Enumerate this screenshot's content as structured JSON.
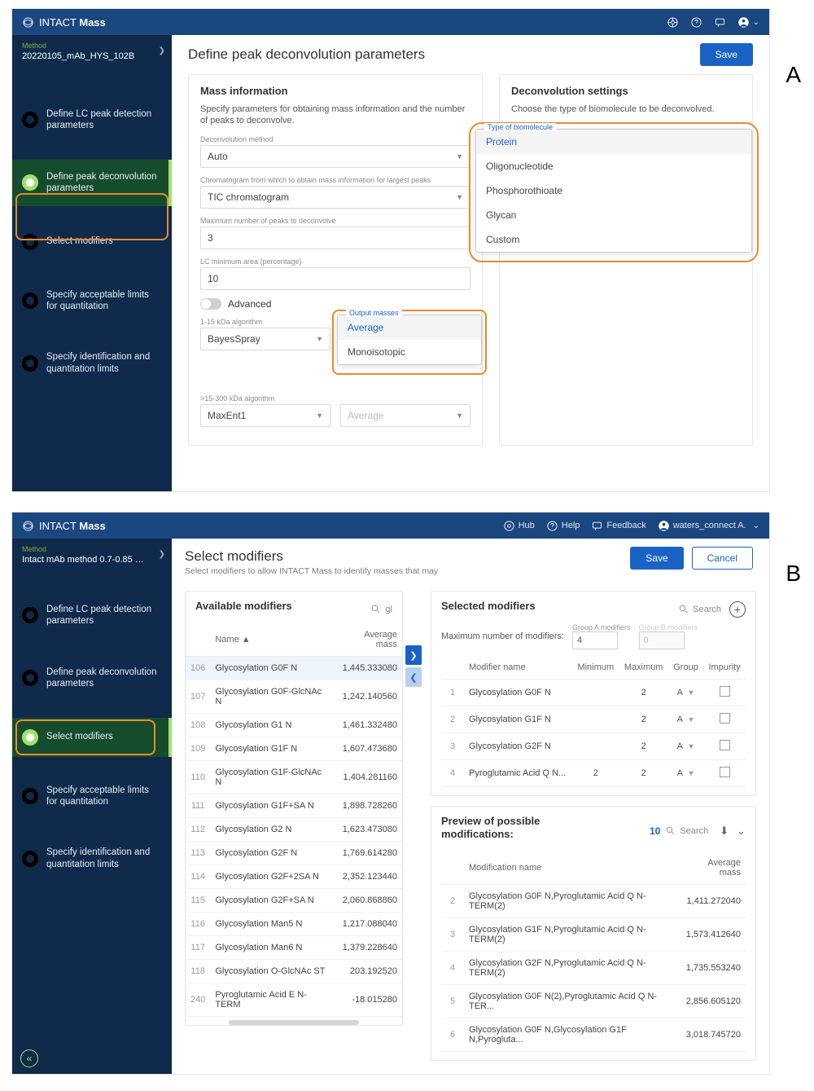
{
  "app_name_pre": "INTACT",
  "app_name_bold": "Mass",
  "hdr_icons": {
    "hub": "Hub",
    "help": "Help",
    "feedback": "Feedback",
    "user": "waters_connect A."
  },
  "panelA": {
    "label": "A",
    "method_label": "Method",
    "method_value": "20220105_mAb_HYS_102B",
    "steps": [
      "Define LC peak detection parameters",
      "Define peak deconvolution parameters",
      "Select modifiers",
      "Specify acceptable limits for quantitation",
      "Specify identification and quantitation limits"
    ],
    "title": "Define peak deconvolution parameters",
    "save": "Save",
    "mi": {
      "head": "Mass information",
      "note": "Specify parameters for obtaining mass information and the number of peaks to deconvolve.",
      "f1l": "Deconvolution method",
      "f1v": "Auto",
      "f2l": "Chromatogram from which to obtain mass information for largest peaks",
      "f2v": "TIC chromatogram",
      "f3l": "Maximum number of peaks to deconvolve",
      "f3v": "3",
      "f4l": "LC minimum area (percentage)",
      "f4v": "10",
      "adv": "Advanced",
      "f5l": "1-15 kDa algorithm",
      "f5v": "BayesSpray",
      "f6l": ">15-300 kDa algorithm",
      "f6v": "MaxEnt1",
      "out_lab": "Output masses",
      "out_opts": [
        "Average",
        "Monoisotopic"
      ],
      "under": "Average"
    },
    "ds": {
      "head": "Deconvolution settings",
      "note": "Choose the type of biomolecule to be deconvolved.",
      "bio_lab": "Type of biomolecule",
      "bio_opts": [
        "Protein",
        "Oligonucleotide",
        "Phosphorothioate",
        "Glycan",
        "Custom"
      ]
    }
  },
  "panelB": {
    "label": "B",
    "method_label": "Method",
    "method_value": "Intact mAb method 0.7-0.85 mi...",
    "steps": [
      "Define LC peak detection parameters",
      "Define peak deconvolution parameters",
      "Select modifiers",
      "Specify acceptable limits for quantitation",
      "Specify identification and quantitation limits"
    ],
    "title": "Select modifiers",
    "sub": "Select modifiers to allow INTACT Mass to identify masses that may",
    "save": "Save",
    "cancel": "Cancel",
    "avail": {
      "head": "Available modifiers",
      "search_val": "gl",
      "cols": {
        "name": "Name ▲",
        "mass": "Average mass"
      },
      "rows": [
        {
          "i": "106",
          "n": "Glycosylation G0F N",
          "m": "1,445.333080"
        },
        {
          "i": "107",
          "n": "Glycosylation G0F-GlcNAc N",
          "m": "1,242.140560"
        },
        {
          "i": "108",
          "n": "Glycosylation G1 N",
          "m": "1,461.332480"
        },
        {
          "i": "109",
          "n": "Glycosylation G1F N",
          "m": "1,607.473680"
        },
        {
          "i": "110",
          "n": "Glycosylation G1F-GlcNAc N",
          "m": "1,404.281160"
        },
        {
          "i": "111",
          "n": "Glycosylation G1F+SA N",
          "m": "1,898.728260"
        },
        {
          "i": "112",
          "n": "Glycosylation G2 N",
          "m": "1,623.473080"
        },
        {
          "i": "113",
          "n": "Glycosylation G2F N",
          "m": "1,769.614280"
        },
        {
          "i": "114",
          "n": "Glycosylation G2F+2SA N",
          "m": "2,352.123440"
        },
        {
          "i": "115",
          "n": "Glycosylation G2F+SA N",
          "m": "2,060.868860"
        },
        {
          "i": "116",
          "n": "Glycosylation Man5 N",
          "m": "1,217.088040"
        },
        {
          "i": "117",
          "n": "Glycosylation Man6 N",
          "m": "1,379.228640"
        },
        {
          "i": "118",
          "n": "Glycosylation O-GlcNAc ST",
          "m": "203.192520"
        },
        {
          "i": "240",
          "n": "Pyroglutamic Acid E N-TERM",
          "m": "-18.015280"
        }
      ]
    },
    "sel": {
      "head": "Selected modifiers",
      "search_ph": "Search",
      "maxlab": "Maximum number of modifiers:",
      "grpA_l": "Group A modifiers",
      "grpA_v": "4",
      "grpB_l": "Group B modifiers",
      "grpB_v": "0",
      "cols": {
        "name": "Modifier name",
        "min": "Minimum",
        "max": "Maximum",
        "grp": "Group",
        "imp": "Impurity"
      },
      "rows": [
        {
          "i": "1",
          "n": "Glycosylation G0F N",
          "min": "",
          "max": "2",
          "g": "A"
        },
        {
          "i": "2",
          "n": "Glycosylation G1F N",
          "min": "",
          "max": "2",
          "g": "A"
        },
        {
          "i": "3",
          "n": "Glycosylation G2F N",
          "min": "",
          "max": "2",
          "g": "A"
        },
        {
          "i": "4",
          "n": "Pyroglutamic Acid Q N...",
          "min": "2",
          "max": "2",
          "g": "A"
        }
      ]
    },
    "prev": {
      "head": "Preview of possible modifications:",
      "count": "10",
      "search_ph": "Search",
      "cols": {
        "name": "Modification name",
        "mass": "Average mass"
      },
      "rows": [
        {
          "i": "2",
          "n": "Glycosylation G0F N,Pyroglutamic Acid Q N-TERM(2)",
          "m": "1,411.272040"
        },
        {
          "i": "3",
          "n": "Glycosylation G1F N,Pyroglutamic Acid Q N-TERM(2)",
          "m": "1,573.412640"
        },
        {
          "i": "4",
          "n": "Glycosylation G2F N,Pyroglutamic Acid Q N-TERM(2)",
          "m": "1,735.553240"
        },
        {
          "i": "5",
          "n": "Glycosylation G0F N(2),Pyroglutamic Acid Q N-TER...",
          "m": "2,856.605120"
        },
        {
          "i": "6",
          "n": "Glycosylation G0F N,Glycosylation G1F N,Pyrogluta...",
          "m": "3,018.745720"
        }
      ]
    }
  }
}
